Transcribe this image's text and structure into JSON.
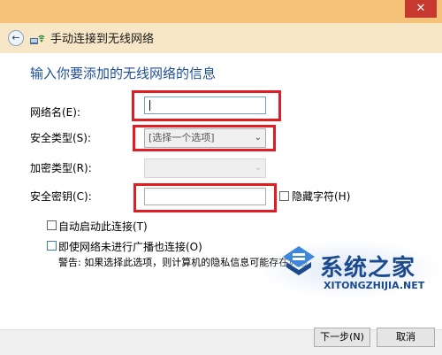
{
  "window": {
    "title": "手动连接到无线网络",
    "close_glyph": "✕"
  },
  "form": {
    "heading": "输入你要添加的无线网络的信息",
    "network_name_label": "网络名(E):",
    "network_name_value": "",
    "security_type_label": "安全类型(S):",
    "security_type_value": "[选择一个选项]",
    "encryption_type_label": "加密类型(R):",
    "encryption_type_value": "",
    "security_key_label": "安全密钥(C):",
    "security_key_value": "",
    "hide_chars_label": "隐藏字符(H)",
    "auto_start_label": "自动启动此连接(T)",
    "connect_hidden_label": "即使网络未进行广播也连接(O)",
    "warning_text": "警告: 如果选择此选项，则计算机的隐私信息可能存在风险。"
  },
  "footer": {
    "next_label": "下一步(N)",
    "cancel_label": "取消"
  },
  "watermark": {
    "brand": "系统之家",
    "url": "XITONGZHIJIA.NET"
  },
  "colors": {
    "titlebar": "#f5c27a",
    "heading": "#1f4e96",
    "highlight": "#e31b23",
    "close": "#c7382f"
  }
}
